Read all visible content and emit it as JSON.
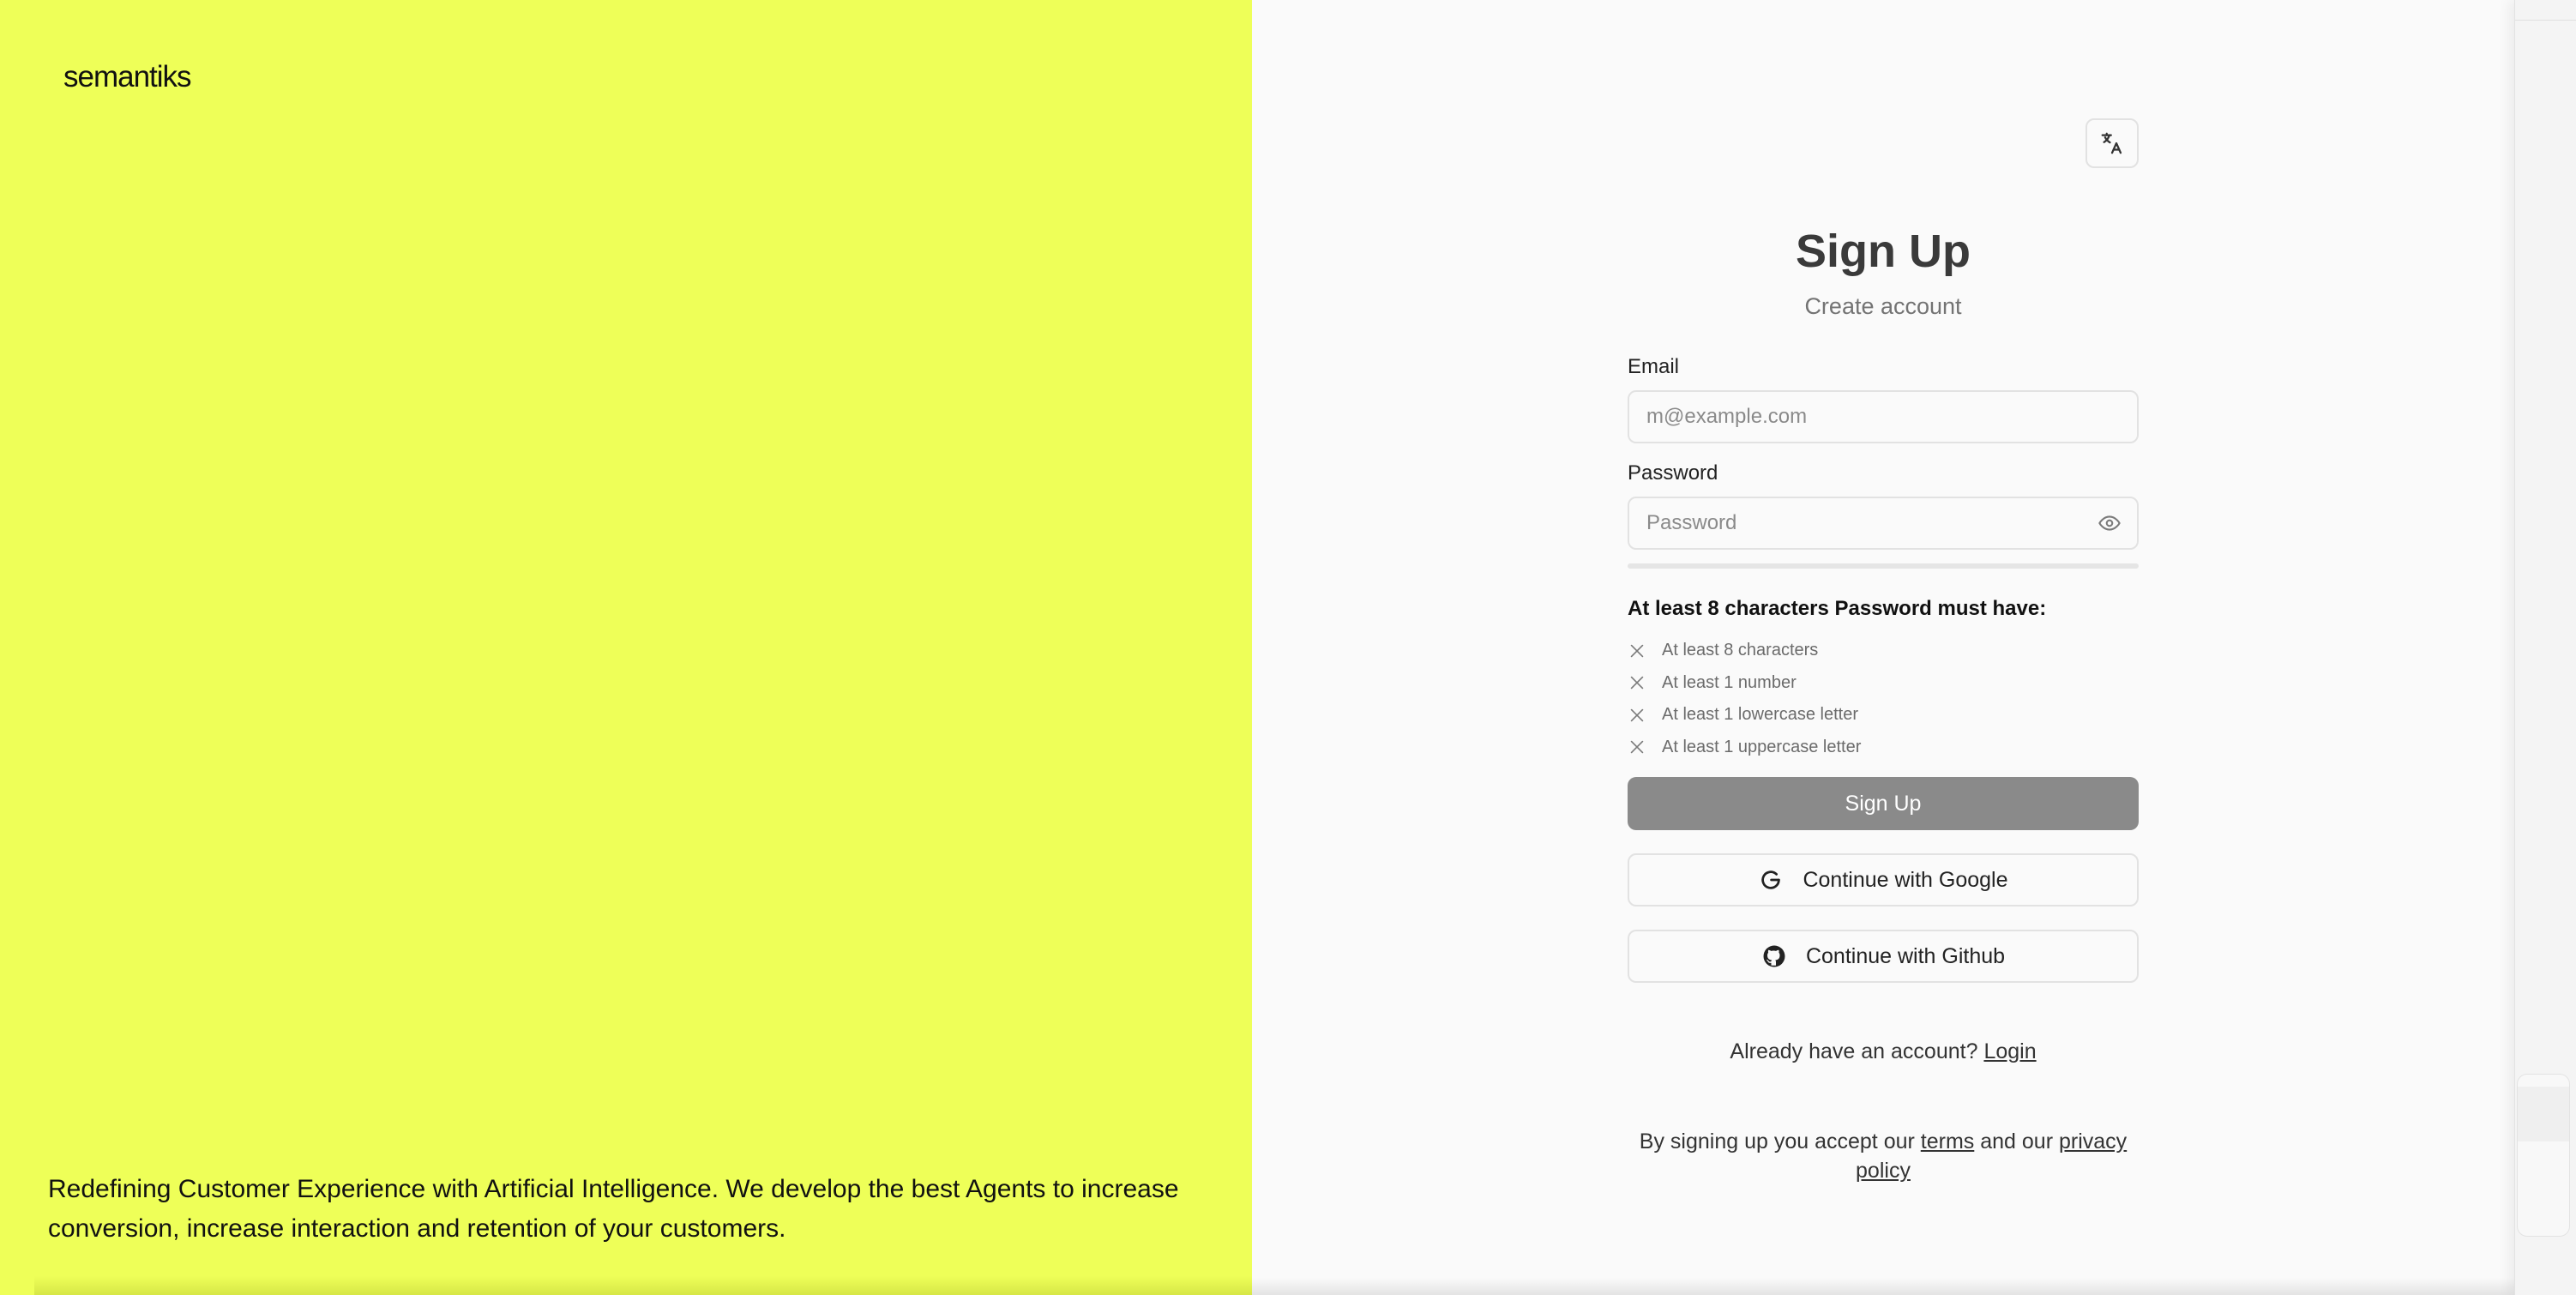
{
  "brand": {
    "logo_text": "semantiks"
  },
  "left": {
    "tagline": "Redefining Customer Experience with Artificial Intelligence. We develop the best Agents to increase conversion, increase interaction and retention of your customers."
  },
  "language_button": {
    "icon": "translate-icon"
  },
  "signup": {
    "title": "Sign Up",
    "subtitle": "Create account",
    "email": {
      "label": "Email",
      "value": "",
      "placeholder": "m@example.com"
    },
    "password": {
      "label": "Password",
      "value": "",
      "placeholder": "Password",
      "toggle_icon": "eye-icon",
      "strength": 0
    },
    "requirements_title": "At least 8 characters Password must have:",
    "requirements": [
      {
        "text": "At least 8 characters",
        "met": false
      },
      {
        "text": "At least 1 number",
        "met": false
      },
      {
        "text": "At least 1 lowercase letter",
        "met": false
      },
      {
        "text": "At least 1 uppercase letter",
        "met": false
      }
    ],
    "submit_label": "Sign Up",
    "google_label": "Continue with Google",
    "github_label": "Continue with Github",
    "login_prompt": "Already have an account?",
    "login_link": "Login",
    "terms_prefix": "By signing up you accept our",
    "terms_link": "terms",
    "terms_middle": "and our",
    "privacy_link": "privacy policy"
  },
  "colors": {
    "left_panel": "#eeff58",
    "right_panel": "#fafafa",
    "submit_disabled": "#8a8a8a",
    "border": "#e2e2e2"
  }
}
